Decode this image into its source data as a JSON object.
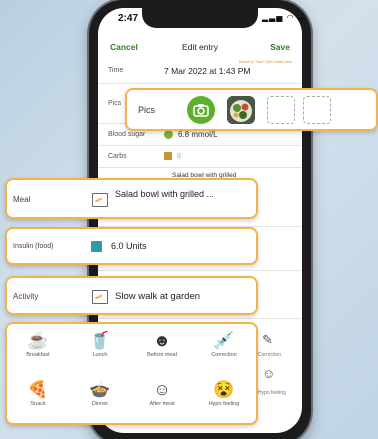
{
  "status": {
    "time": "2:47",
    "icons": "▂▃▅ ◠ ▬"
  },
  "nav": {
    "cancel": "Cancel",
    "title": "Edit entry",
    "save": "Save"
  },
  "time_row": {
    "label": "Time",
    "value": "7 Mar 2022 at 1:43 PM",
    "note": "Default is \"Time\" (See Guide) time"
  },
  "pics_row": {
    "label": "Pics"
  },
  "blood_sugar": {
    "label": "Blood sugar",
    "value": "6.8 mmol/L"
  },
  "carbs": {
    "label": "Carbs",
    "value": "g"
  },
  "meal_peek": "Salad bowl with grilled",
  "bg_labels": {
    "correction": "Correction",
    "hypo": "Hypo feeling"
  },
  "pics_card": {
    "label": "Pics"
  },
  "meal": {
    "label": "Meal",
    "value": "Salad bowl with grilled ..."
  },
  "insulin": {
    "label": "Insulin (food)",
    "value": "6.0 Units"
  },
  "activity": {
    "label": "Activity",
    "value": "Slow walk at garden"
  },
  "tags": [
    {
      "label": "Breakfast",
      "icon": "coffee-cup-icon"
    },
    {
      "label": "Lunch",
      "icon": "drink-glass-icon"
    },
    {
      "label": "Before meal",
      "icon": "face-mask-icon"
    },
    {
      "label": "Correction",
      "icon": "syringe-icon"
    },
    {
      "label": "Snack",
      "icon": "pizza-slice-icon"
    },
    {
      "label": "Dinner",
      "icon": "bowl-icon"
    },
    {
      "label": "After meal",
      "icon": "face-icon"
    },
    {
      "label": "Hypo feeling",
      "icon": "dizzy-face-icon"
    }
  ],
  "colors": {
    "accent": "#f3b34a",
    "green": "#5cb02e",
    "insulin": "#2d9aa8"
  }
}
